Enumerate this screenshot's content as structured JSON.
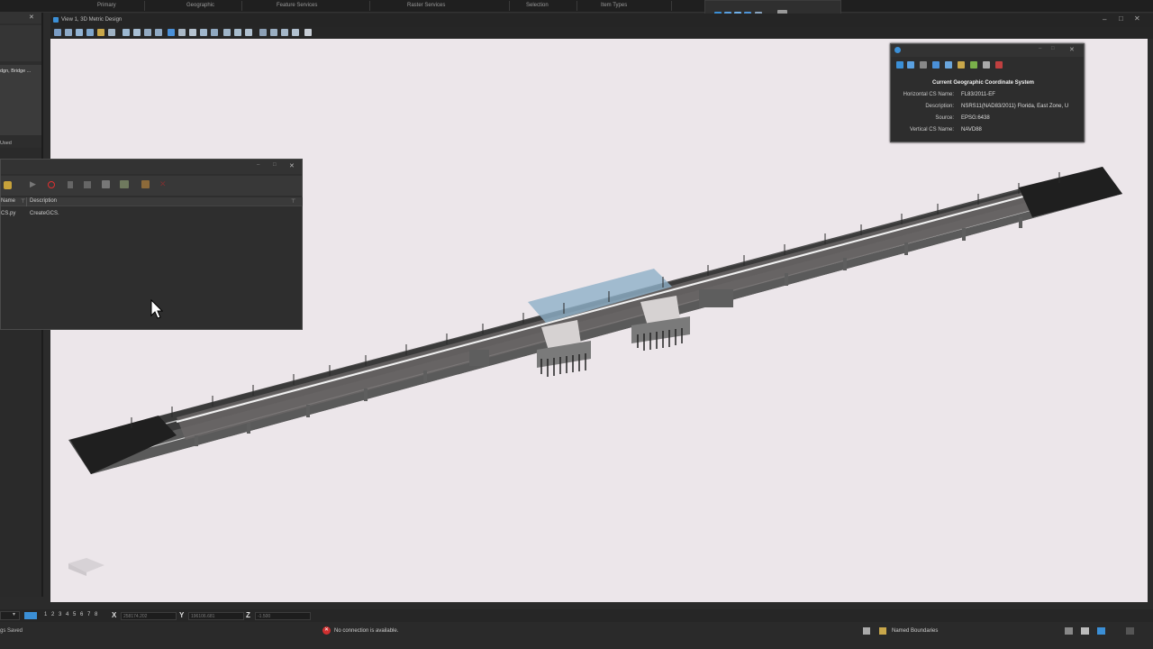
{
  "ribbon": {
    "groups": [
      "Primary",
      "Geographic",
      "Feature Services",
      "Raster Services",
      "Selection",
      "Item Types"
    ]
  },
  "view": {
    "title": "View 1, 3D Metric Design"
  },
  "left_panel": {
    "item_text": "dgn, Bridge ...",
    "used_label": "Used"
  },
  "macro_dialog": {
    "columns": [
      "Name",
      "Description"
    ],
    "rows": [
      {
        "name": "CS.py",
        "description": "CreateGCS."
      }
    ]
  },
  "gcs_panel": {
    "heading": "Current Geographic Coordinate System",
    "fields": [
      {
        "label": "Horizontal CS Name:",
        "value": "FL83/2011-EF"
      },
      {
        "label": "Description:",
        "value": "NSRS11(NAD83/2011) Florida, East Zone, U"
      },
      {
        "label": "Source:",
        "value": "EPSG:6438"
      },
      {
        "label": "Vertical CS Name:",
        "value": "NAVD88"
      }
    ]
  },
  "status": {
    "views": [
      "1",
      "2",
      "3",
      "4",
      "5",
      "6",
      "7",
      "8"
    ],
    "x_label": "X",
    "y_label": "Y",
    "z_label": "Z",
    "x_value": "258174.202",
    "y_value": "196106.681",
    "z_value": "-1.500",
    "connection": "No connection is available.",
    "boundaries": "Named Boundaries",
    "saved": "gs Saved"
  },
  "colors": {
    "viewport_bg": "#ece6ea",
    "panel_bg": "#2d2d2d",
    "accent_blue": "#3b8fd6",
    "record_red": "#e03030"
  }
}
